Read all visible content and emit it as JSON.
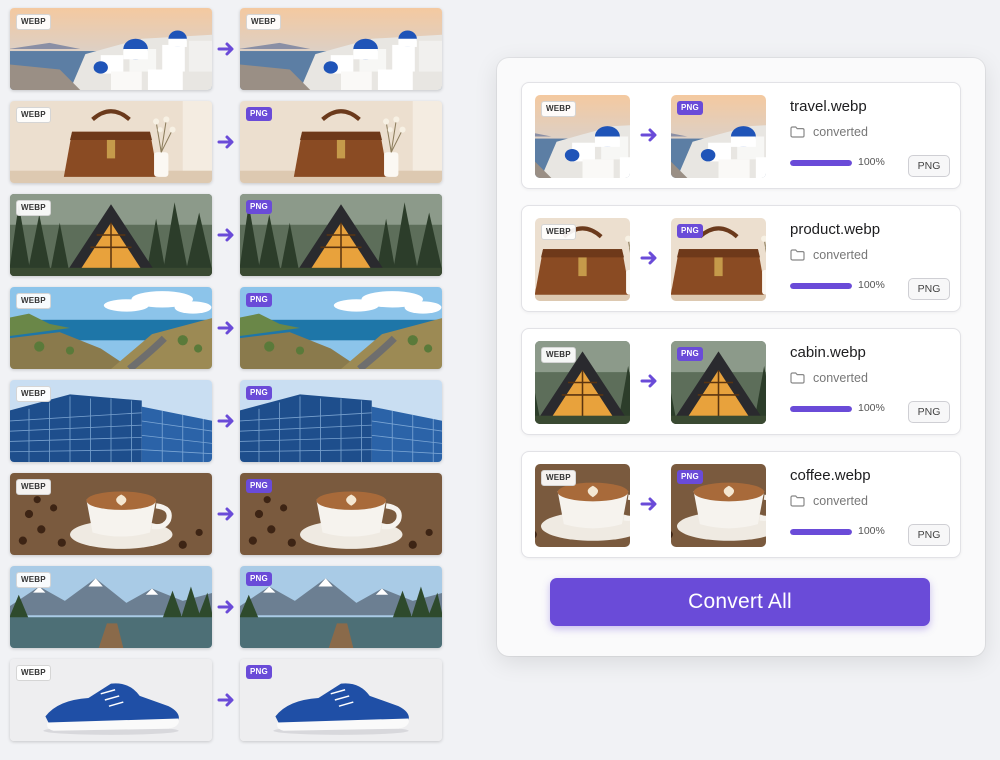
{
  "accent": "#6a4bd8",
  "grid": [
    {
      "scene": "santorini",
      "source_format": "WEBP",
      "target_format": "WEBP"
    },
    {
      "scene": "handbag",
      "source_format": "WEBP",
      "target_format": "PNG"
    },
    {
      "scene": "cabin",
      "source_format": "WEBP",
      "target_format": "PNG"
    },
    {
      "scene": "coast",
      "source_format": "WEBP",
      "target_format": "PNG"
    },
    {
      "scene": "building",
      "source_format": "WEBP",
      "target_format": "PNG"
    },
    {
      "scene": "coffee",
      "source_format": "WEBP",
      "target_format": "PNG"
    },
    {
      "scene": "mountain-lake",
      "source_format": "WEBP",
      "target_format": "PNG"
    },
    {
      "scene": "sneaker",
      "source_format": "WEBP",
      "target_format": "PNG"
    }
  ],
  "files": [
    {
      "name": "travel.webp",
      "scene": "santorini",
      "source_format": "WEBP",
      "target_format": "PNG",
      "status": "converted",
      "progress": 100,
      "progress_label": "100%",
      "format_button": "PNG"
    },
    {
      "name": "product.webp",
      "scene": "handbag",
      "source_format": "WEBP",
      "target_format": "PNG",
      "status": "converted",
      "progress": 100,
      "progress_label": "100%",
      "format_button": "PNG"
    },
    {
      "name": "cabin.webp",
      "scene": "cabin",
      "source_format": "WEBP",
      "target_format": "PNG",
      "status": "converted",
      "progress": 100,
      "progress_label": "100%",
      "format_button": "PNG"
    },
    {
      "name": "coffee.webp",
      "scene": "coffee",
      "source_format": "WEBP",
      "target_format": "PNG",
      "status": "converted",
      "progress": 100,
      "progress_label": "100%",
      "format_button": "PNG"
    }
  ],
  "convert_all_label": "Convert All"
}
